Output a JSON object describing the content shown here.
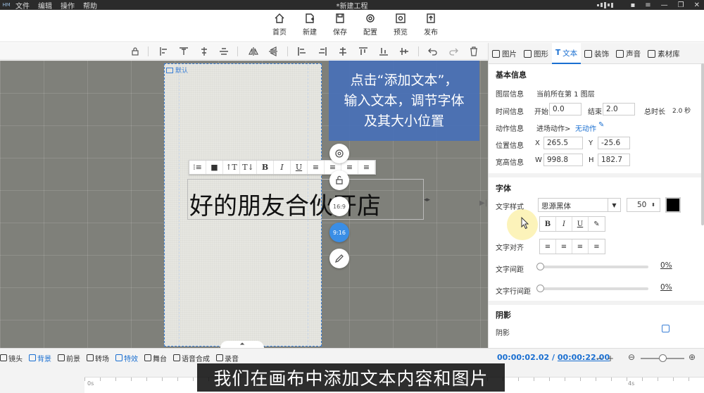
{
  "app": {
    "logo": "HM",
    "menu": [
      "文件",
      "编辑",
      "操作",
      "帮助"
    ],
    "title": "*新建工程"
  },
  "toolbar": {
    "home": "首页",
    "new": "新建",
    "save": "保存",
    "config": "配置",
    "preview": "预览",
    "publish": "发布"
  },
  "canvas": {
    "stage_label": "默认",
    "hint": [
      "点击“添加文本”，",
      "输入文本，调节字体",
      "及其大小位置"
    ],
    "text_content": "好的朋友合伙开店",
    "text_toolbar": [
      "⁝≡",
      "■",
      "↑T",
      "T↓",
      "B",
      "I",
      "U",
      "≡",
      "≡",
      "≡",
      "≡"
    ],
    "ratio_16_9": "16:9",
    "ratio_9_16": "9:16",
    "collapse": "⏶"
  },
  "panel": {
    "tabs": [
      "图片",
      "图形",
      "文本",
      "装饰",
      "声音",
      "素材库"
    ],
    "active_tab": "文本",
    "basic_info": "基本信息",
    "layer_label": "图层信息",
    "layer_value": "当前所在第 1 图层",
    "time_label": "时间信息",
    "start_label": "开始",
    "start_value": "0.0",
    "end_label": "结束",
    "end_value": "2.0",
    "duration_label": "总时长",
    "duration_value": "2.0 秒",
    "action_label": "动作信息",
    "enter_action": "进场动作>",
    "no_action": "无动作",
    "pos_label": "位置信息",
    "x_label": "X",
    "x_value": "265.5",
    "y_label": "Y",
    "y_value": "-25.6",
    "size_label": "宽高信息",
    "w_label": "W",
    "w_value": "998.8",
    "h_label": "H",
    "h_value": "182.7",
    "font_section": "字体",
    "font_style_label": "文字样式",
    "font_name": "思源黑体",
    "font_size": "50",
    "font_buttons": [
      "B",
      "I",
      "U",
      "✎"
    ],
    "align_label": "文字对齐",
    "align_buttons": [
      "≡",
      "≡",
      "≡",
      "≡"
    ],
    "spacing_label": "文字间距",
    "spacing_value": "0%",
    "line_spacing_label": "文字行间距",
    "line_spacing_value": "0%",
    "shadow_section": "阴影",
    "shadow_label": "阴影",
    "text_color": "#000000"
  },
  "timeline": {
    "items": [
      "镜头",
      "背景",
      "前景",
      "转场",
      "特效",
      "舞台",
      "语音合成",
      "录音"
    ],
    "active_items": [
      "背景",
      "特效"
    ],
    "current_time": "00:00:02.02",
    "total_time": "00:00:22.00",
    "ruler_start": "0s",
    "ruler_mark": "4s"
  },
  "subtitle": "我们在画布中添加文本内容和图片"
}
